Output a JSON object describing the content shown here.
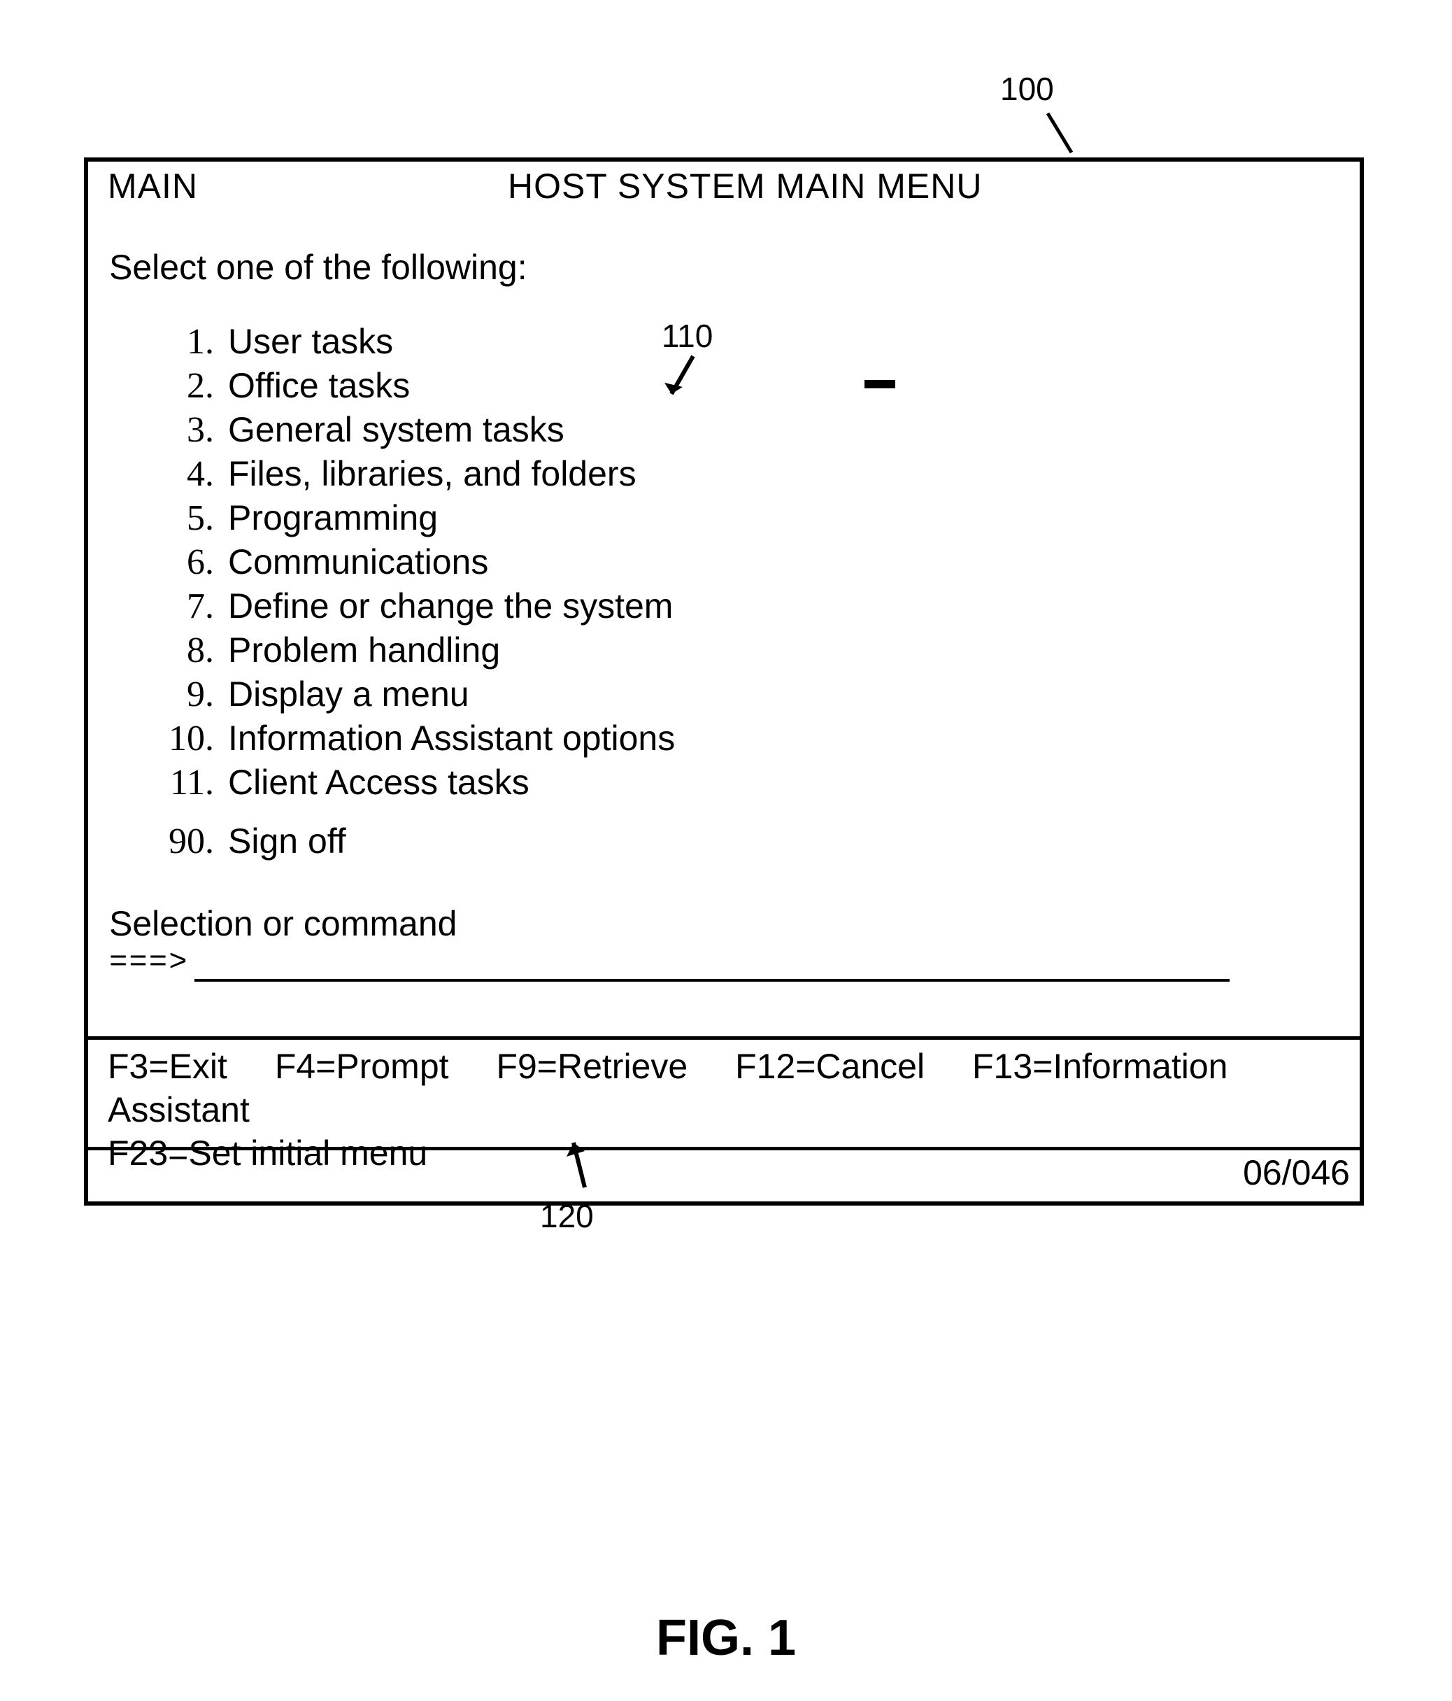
{
  "callouts": {
    "ref100": "100",
    "ref110": "110",
    "ref120": "120"
  },
  "terminal": {
    "screen_name": "MAIN",
    "title": "HOST SYSTEM MAIN MENU",
    "prompt": "Select one of the following:",
    "menu_items": [
      {
        "num": "1.",
        "label": "User tasks"
      },
      {
        "num": "2.",
        "label": "Office tasks"
      },
      {
        "num": "3.",
        "label": "General system tasks"
      },
      {
        "num": "4.",
        "label": "Files, libraries, and folders"
      },
      {
        "num": "5.",
        "label": "Programming"
      },
      {
        "num": "6.",
        "label": "Communications"
      },
      {
        "num": "7.",
        "label": "Define or change the system"
      },
      {
        "num": "8.",
        "label": "Problem handling"
      },
      {
        "num": "9.",
        "label": "Display a menu"
      },
      {
        "num": "10.",
        "label": "Information Assistant options"
      },
      {
        "num": "11.",
        "label": "Client Access tasks"
      }
    ],
    "signoff": {
      "num": "90.",
      "label": "Sign off"
    },
    "command_label": "Selection or command",
    "command_arrow": "===>",
    "command_value": "",
    "fkeys": [
      "F3=Exit",
      "F4=Prompt",
      "F9=Retrieve",
      "F12=Cancel",
      "F13=Information Assistant",
      "F23=Set initial menu"
    ],
    "status": "06/046"
  },
  "figure_caption": "FIG. 1"
}
